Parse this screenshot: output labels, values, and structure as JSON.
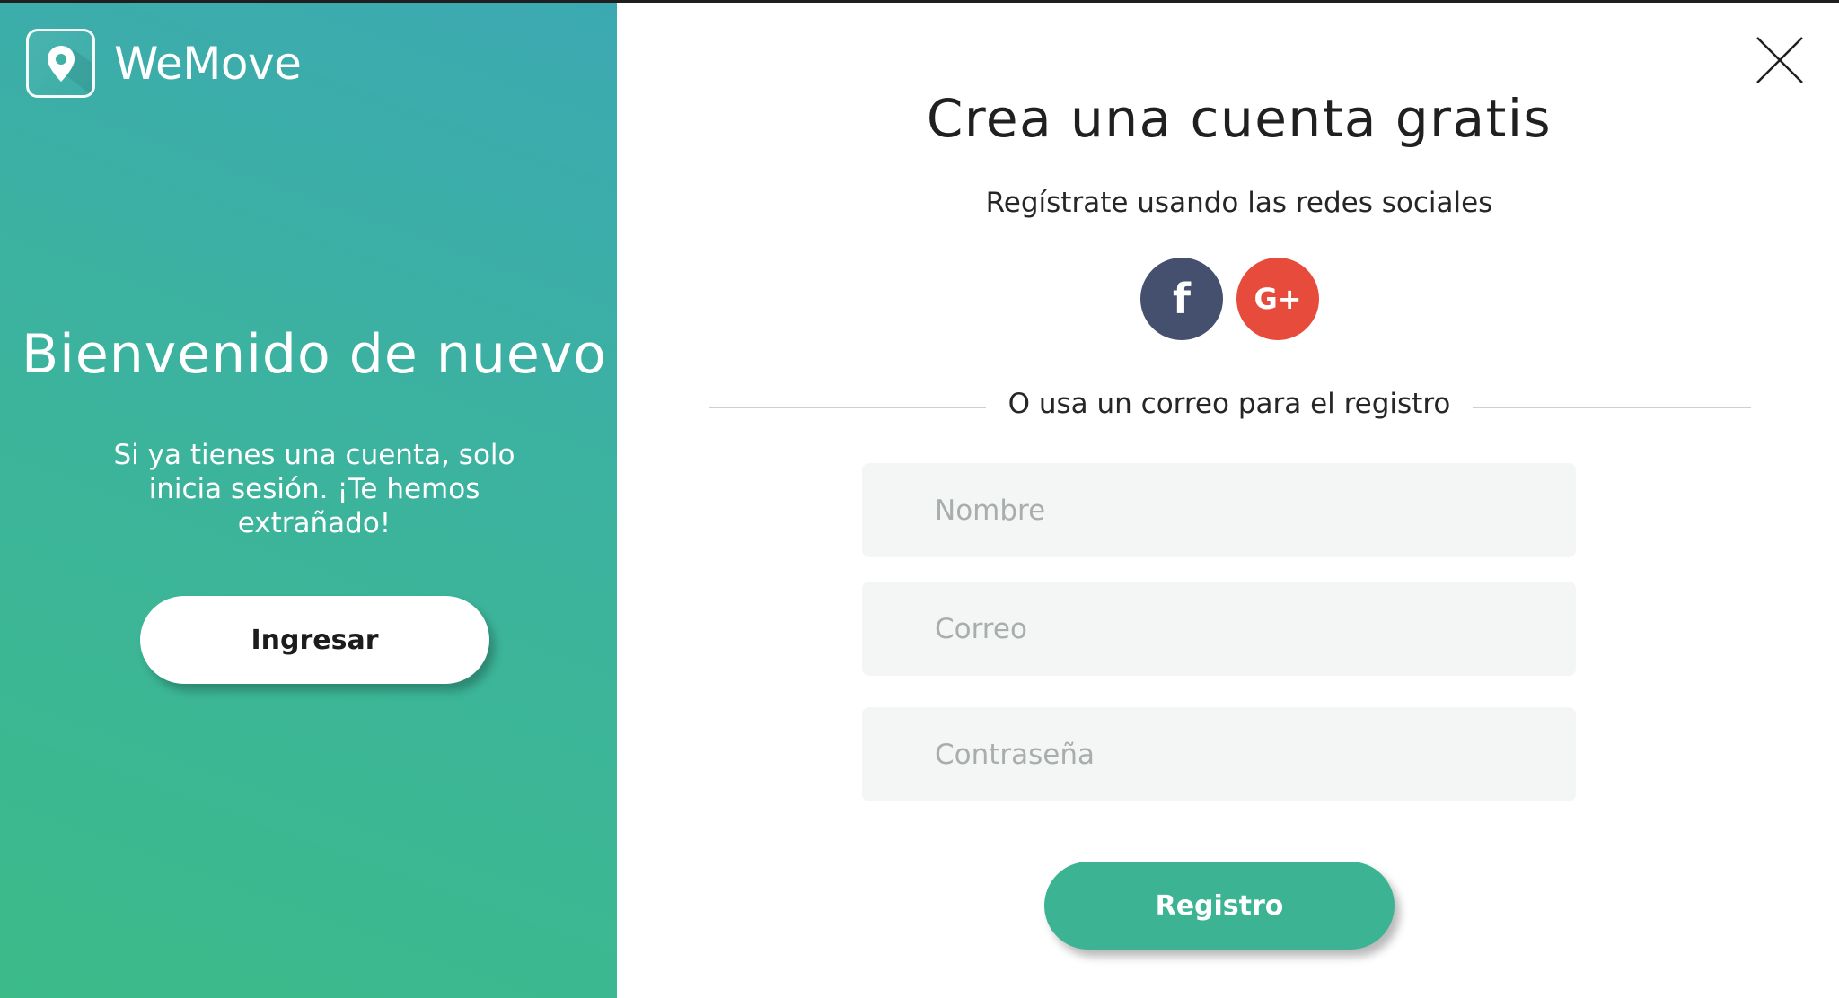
{
  "brand": {
    "name": "WeMove",
    "logo_icon": "map-pin-icon",
    "accent_color": "#3cb493"
  },
  "welcome": {
    "title": "Bienvenido de nuevo",
    "message": "Si ya tienes una cuenta, solo inicia sesión. ¡Te hemos extrañado!",
    "login_label": "Ingresar"
  },
  "signup": {
    "title": "Crea una cuenta gratis",
    "social_subtitle": "Regístrate usando las redes sociales",
    "social": [
      {
        "name": "facebook",
        "label": "f",
        "color": "#44506e"
      },
      {
        "name": "google-plus",
        "label": "G+",
        "color": "#e64b3b"
      }
    ],
    "divider_text": "O usa un correo para el registro",
    "fields": {
      "name_placeholder": "Nombre",
      "email_placeholder": "Correo",
      "password_placeholder": "Contraseña"
    },
    "submit_label": "Registro"
  },
  "close_icon": "close-icon"
}
